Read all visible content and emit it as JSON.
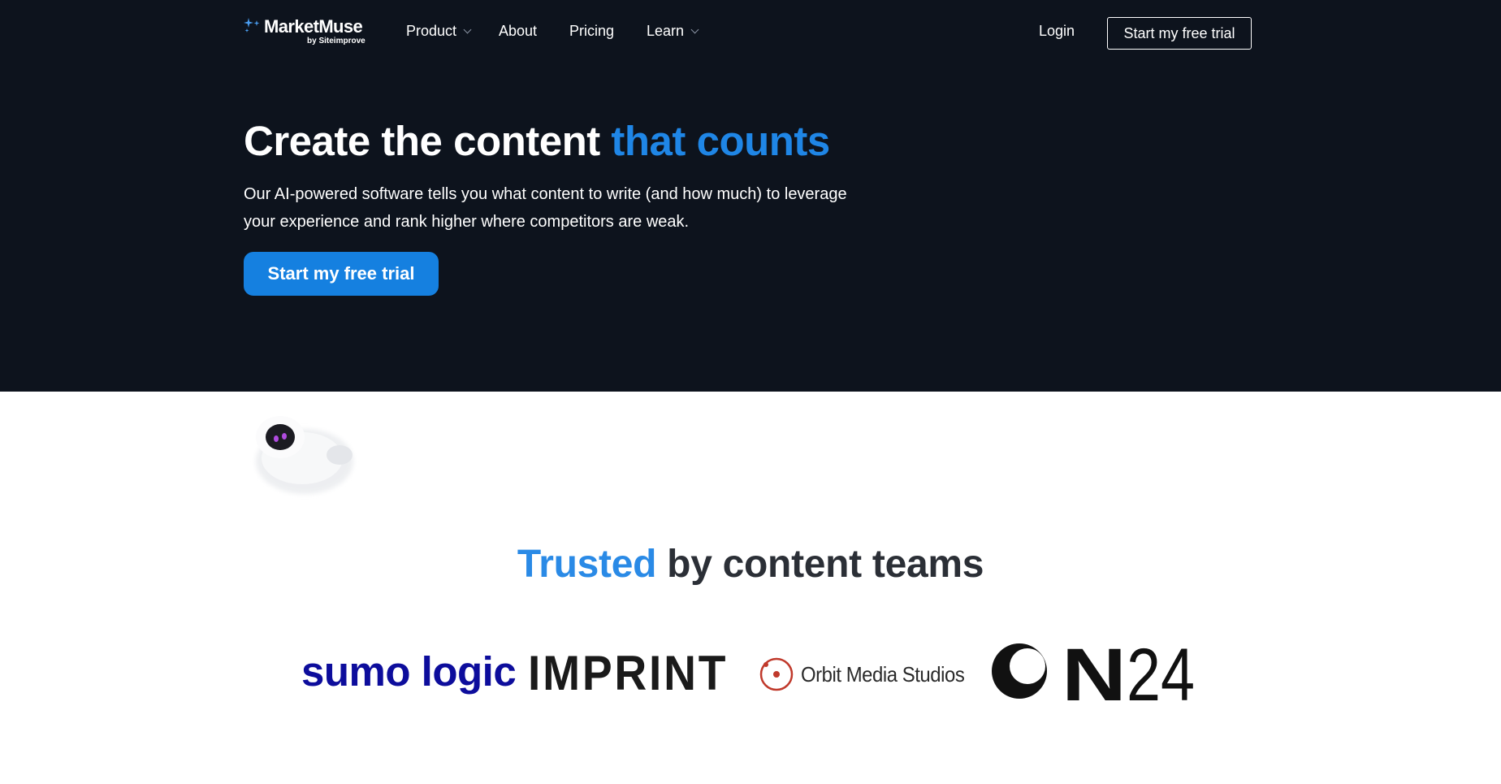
{
  "nav": {
    "logo_name": "MarketMuse",
    "logo_sub": "by Siteimprove",
    "items": [
      {
        "label": "Product",
        "has_dropdown": true
      },
      {
        "label": "About",
        "has_dropdown": false
      },
      {
        "label": "Pricing",
        "has_dropdown": false
      },
      {
        "label": "Learn",
        "has_dropdown": true
      }
    ],
    "login": "Login",
    "cta": "Start my free trial"
  },
  "hero": {
    "title_main": "Create the content ",
    "title_accent": "that counts",
    "description": "Our AI-powered software tells you what content to write (and how much) to leverage your experience and rank higher where competitors are weak.",
    "cta": "Start my free trial"
  },
  "trusted": {
    "accent": "Trusted",
    "rest": " by content teams"
  },
  "logos": {
    "sumo": "sumo logic",
    "imprint": "IMPRINT",
    "orbit": "Orbit Media Studios",
    "on24": "ON24"
  },
  "colors": {
    "hero_bg": "#0d131d",
    "accent_blue": "#1f86e6",
    "button_blue": "#1580e0",
    "sumo_navy": "#0d0d9c",
    "orbit_red": "#c0392b"
  },
  "icons": [
    "sparkle-stars-icon",
    "chevron-down-icon",
    "orbit-icon",
    "robot-mascot-icon"
  ]
}
